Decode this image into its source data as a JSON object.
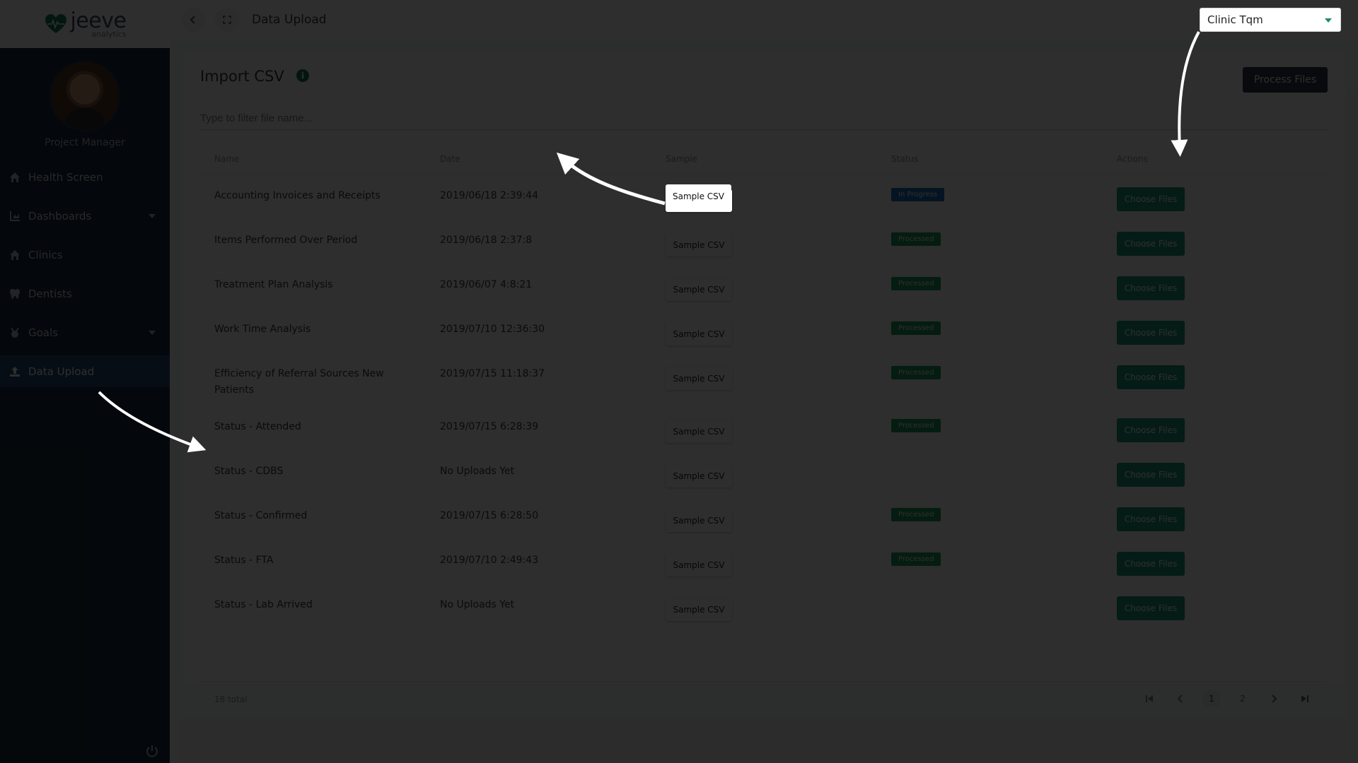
{
  "brand": {
    "logo_word": "jeeve",
    "logo_sub": "analytics"
  },
  "profile": {
    "role": "Project Manager"
  },
  "sidebar": {
    "items": [
      {
        "label": "Health Screen",
        "icon": "home-icon"
      },
      {
        "label": "Dashboards",
        "icon": "chart-icon",
        "has_caret": true
      },
      {
        "label": "Clinics",
        "icon": "home-icon"
      },
      {
        "label": "Dentists",
        "icon": "tooth-icon"
      },
      {
        "label": "Goals",
        "icon": "medal-icon",
        "has_caret": true
      },
      {
        "label": "Data Upload",
        "icon": "upload-icon",
        "active": true
      }
    ]
  },
  "topbar": {
    "title": "Data Upload",
    "clinic": "Clinic Tqm"
  },
  "card": {
    "title": "Import CSV",
    "process_label": "Process Files",
    "filter_placeholder": "Type to filter file name..."
  },
  "table": {
    "headers": [
      "Name",
      "Date",
      "Sample",
      "Status",
      "Actions"
    ],
    "sample_label": "Sample CSV",
    "action_label": "Choose Files",
    "rows": [
      {
        "name": "Accounting Invoices and Receipts",
        "date": "2019/06/18 2:39:44",
        "status": "In Progress"
      },
      {
        "name": "Items Performed Over Period",
        "date": "2019/06/18 2:37:8",
        "status": "Processed"
      },
      {
        "name": "Treatment Plan Analysis",
        "date": "2019/06/07 4:8:21",
        "status": "Processed"
      },
      {
        "name": "Work Time Analysis",
        "date": "2019/07/10 12:36:30",
        "status": "Processed"
      },
      {
        "name": "Efficiency of Referral Sources New Patients",
        "date": "2019/07/15 11:18:37",
        "status": "Processed"
      },
      {
        "name": "Status - Attended",
        "date": "2019/07/15 6:28:39",
        "status": "Processed"
      },
      {
        "name": "Status - CDBS",
        "date": "No Uploads Yet",
        "status": ""
      },
      {
        "name": "Status - Confirmed",
        "date": "2019/07/15 6:28:50",
        "status": "Processed"
      },
      {
        "name": "Status - FTA",
        "date": "2019/07/10 2:49:43",
        "status": "Processed"
      },
      {
        "name": "Status - Lab Arrived",
        "date": "No Uploads Yet",
        "status": ""
      }
    ],
    "total": "18 total",
    "pages": [
      "1",
      "2"
    ]
  },
  "colors": {
    "sidebar": "#182a3c",
    "active": "#24496f",
    "accent": "#1e9b78",
    "progress": "#1f6ec1"
  }
}
